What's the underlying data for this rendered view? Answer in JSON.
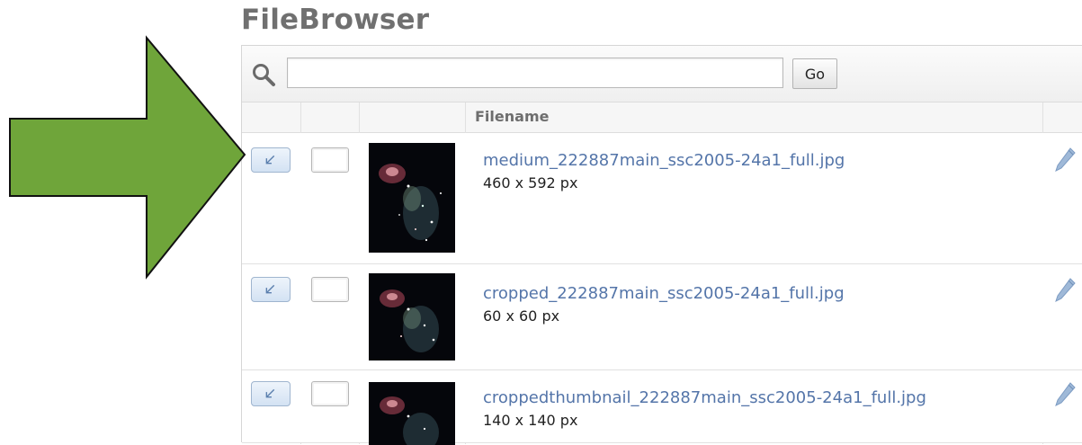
{
  "app": {
    "title": "FileBrowser"
  },
  "search": {
    "value": "",
    "placeholder": "",
    "go_label": "Go"
  },
  "table": {
    "columns": [
      "",
      "",
      "",
      "Filename",
      ""
    ],
    "rows": [
      {
        "filename": "medium_222887main_ssc2005-24a1_full.jpg",
        "dimensions": "460 x 592 px"
      },
      {
        "filename": "cropped_222887main_ssc2005-24a1_full.jpg",
        "dimensions": "60 x 60 px"
      },
      {
        "filename": "croppedthumbnail_222887main_ssc2005-24a1_full.jpg",
        "dimensions": "140 x 140 px"
      }
    ]
  },
  "annotation": {
    "arrow_color": "#6fa53a"
  },
  "icons": {
    "search": "search-icon",
    "insert": "insert-arrow-icon",
    "select": "checkbox-icon",
    "edit": "pencil-icon"
  }
}
